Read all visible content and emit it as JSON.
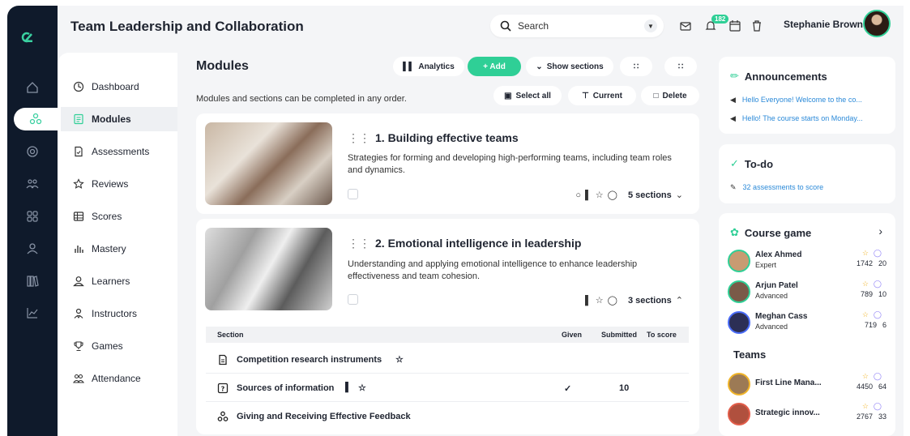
{
  "header": {
    "title": "Team Leadership and Collaboration",
    "search_placeholder": "Search",
    "notification_count": "182",
    "user_name": "Stephanie Brown"
  },
  "sidebar": {
    "items": [
      {
        "label": "Dashboard",
        "icon": "dashboard-icon"
      },
      {
        "label": "Modules",
        "icon": "modules-icon",
        "active": true
      },
      {
        "label": "Assessments",
        "icon": "assessments-icon"
      },
      {
        "label": "Reviews",
        "icon": "star-icon"
      },
      {
        "label": "Scores",
        "icon": "table-icon"
      },
      {
        "label": "Mastery",
        "icon": "bar-chart-icon"
      },
      {
        "label": "Learners",
        "icon": "user-icon"
      },
      {
        "label": "Instructors",
        "icon": "instructor-icon"
      },
      {
        "label": "Games",
        "icon": "trophy-icon"
      },
      {
        "label": "Attendance",
        "icon": "group-icon"
      }
    ]
  },
  "main": {
    "title": "Modules",
    "subtitle": "Modules and sections can be completed in any order.",
    "buttons": {
      "analytics": "Analytics",
      "add": "+  Add",
      "show_sections": "Show sections",
      "select_all": "Select all",
      "current": "Current",
      "delete": "Delete"
    },
    "modules": [
      {
        "title": "1. Building effective teams",
        "description": "Strategies for forming and developing high-performing teams, including team roles and dynamics.",
        "sections": "5 sections"
      },
      {
        "title": "2. Emotional intelligence in leadership",
        "description": "Understanding and applying emotional intelligence to enhance leadership effectiveness and team cohesion.",
        "sections": "3 sections"
      }
    ],
    "table": {
      "headers": {
        "section": "Section",
        "given": "Given",
        "submitted": "Submitted",
        "to_score": "To score"
      },
      "rows": [
        {
          "name": "Competition research instruments",
          "given": "",
          "submitted": ""
        },
        {
          "name": "Sources of information",
          "given": "✓",
          "submitted": "10"
        },
        {
          "name": "Giving and Receiving Effective Feedback",
          "given": "",
          "submitted": ""
        }
      ]
    }
  },
  "right": {
    "announcements": {
      "title": "Announcements",
      "items": [
        "Hello Everyone! Welcome to the co...",
        "Hello! The course starts on Monday..."
      ]
    },
    "todo": {
      "title": "To-do",
      "item": "32 assessments to score"
    },
    "game": {
      "title": "Course game",
      "players": [
        {
          "name": "Alex Ahmed",
          "level": "Expert",
          "points": "1742",
          "badges": "20"
        },
        {
          "name": "Arjun Patel",
          "level": "Advanced",
          "points": "789",
          "badges": "10"
        },
        {
          "name": "Meghan Cass",
          "level": "Advanced",
          "points": "719",
          "badges": "6"
        }
      ],
      "teams_title": "Teams",
      "teams": [
        {
          "name": "First Line Mana...",
          "points": "4450",
          "badges": "64"
        },
        {
          "name": "Strategic innov...",
          "points": "2767",
          "badges": "33"
        }
      ]
    }
  },
  "colors": {
    "accent": "#2fcf96",
    "rail": "#0f1a2b",
    "link": "#2a89d8"
  }
}
